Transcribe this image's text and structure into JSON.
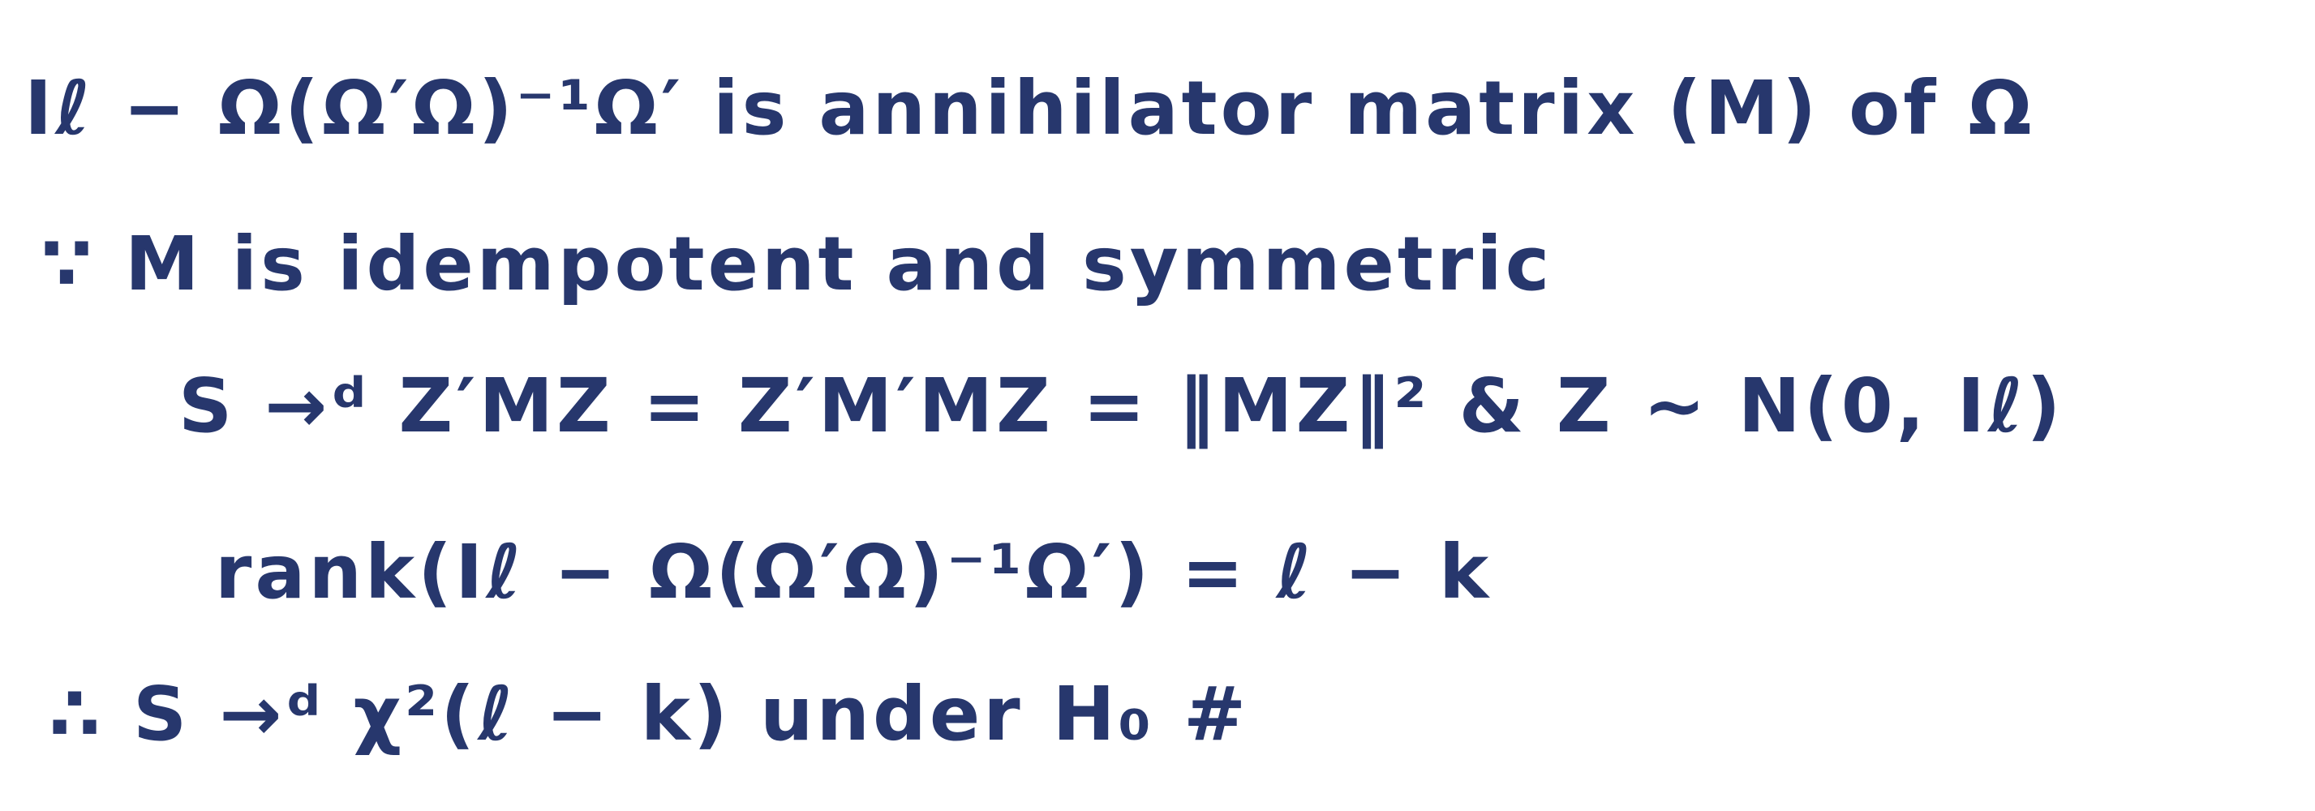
{
  "note": {
    "ink_color": "#27376d",
    "lines": [
      "Iℓ − Ω(Ω′Ω)⁻¹Ω′  is annihilator matrix (M) of Ω",
      "∵ M is idempotent and symmetric",
      "S →ᵈ Z′MZ = Z′M′MZ = ‖MZ‖² & Z ~ N(0, Iℓ)",
      "rank(Iℓ − Ω(Ω′Ω)⁻¹Ω′) = ℓ − k",
      "∴ S →ᵈ χ²(ℓ − k) under H₀ #"
    ]
  }
}
